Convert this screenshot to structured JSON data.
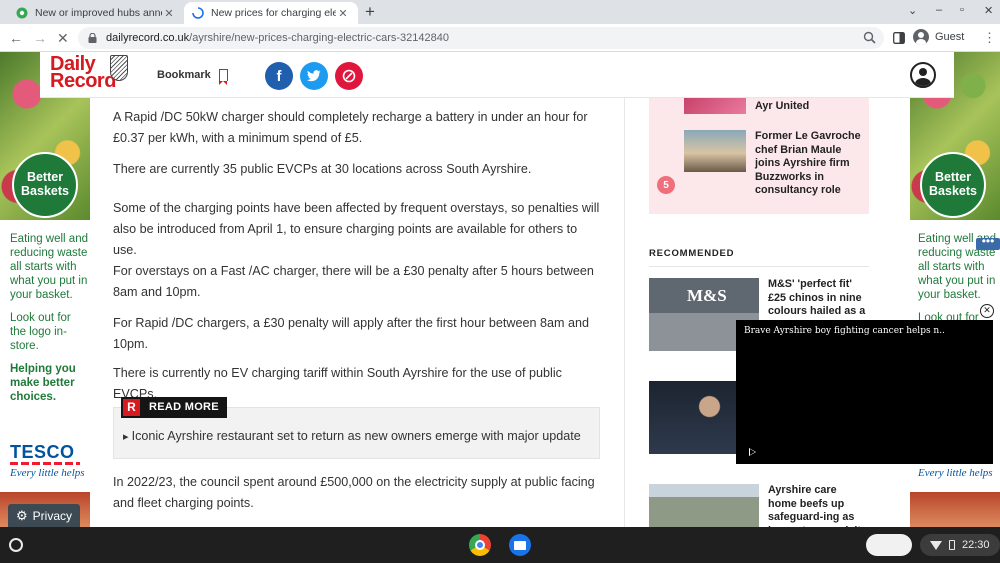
{
  "browser": {
    "tabs": [
      {
        "title": "New or improved hubs announc",
        "active": false
      },
      {
        "title": "New prices for charging electric",
        "active": true
      }
    ],
    "new_tab": "+",
    "url_host": "dailyrecord.co.uk",
    "url_path": "/ayrshire/new-prices-charging-electric-cars-32142840",
    "profile_label": "Guest",
    "window_controls": [
      "⌄",
      "–",
      "▫",
      "✕"
    ]
  },
  "site": {
    "logo_line1": "Daily",
    "logo_line2": "Record",
    "bookmark_label": "Bookmark",
    "share": {
      "facebook": "f",
      "twitter": "t",
      "link": "⊘"
    }
  },
  "article": {
    "paragraphs": [
      "A Rapid /DC 50kW charger should completely recharge a battery in under an hour for £0.37 per kWh, with a minimum spend of £5.",
      "There are currently 35 public EVCPs at 30 locations across South Ayrshire.",
      "Some of the charging points have been affected by frequent overstays, so penalties will also be introduced from April 1, to ensure charging points are available for others to use.",
      "For overstays on a Fast /AC charger, there will be a £30 penalty after 5 hours between 8am and 10pm.",
      "For Rapid /DC chargers, a £30 penalty will apply after the first hour between 8am and 10pm.",
      "There is currently no EV charging tariff within South Ayrshire for the use of public EVCPs.",
      "In 2022/23, the council spent around £500,000 on the electricity supply at public facing and fleet charging points."
    ],
    "read_more": {
      "badge": "R",
      "label": "READ MORE",
      "link": "Iconic Ayrshire restaurant set to return as new owners emerge with major update"
    }
  },
  "sidebar": {
    "trending": [
      {
        "number": "",
        "title": "Ayr United"
      },
      {
        "number": "5",
        "title": "Former Le Gavroche chef Brian Maule joins Ayrshire firm Buzzworks in consultancy role"
      }
    ],
    "recommended_heading": "RECOMMENDED",
    "recommended": [
      {
        "title": "M&S' 'perfect fit' £25 chinos in nine colours hailed as a",
        "image_text": "M&S"
      },
      {
        "title": ""
      },
      {
        "title": "Ayrshire care home beefs up safeguard-ing as inspectors re-visit adult service"
      }
    ]
  },
  "video": {
    "title": "Brave Ayrshire boy fighting cancer helps n...",
    "close": "✕",
    "more": "•••"
  },
  "ads": {
    "badge": "Better Baskets",
    "lines": [
      "Eating well and reducing waste all starts with what you put in your basket.",
      "Look out for the logo in-store.",
      "Helping you make better choices."
    ],
    "brand": "TESCO",
    "tagline": "Every little helps"
  },
  "privacy_label": "Privacy",
  "shelf": {
    "time": "22:30"
  }
}
